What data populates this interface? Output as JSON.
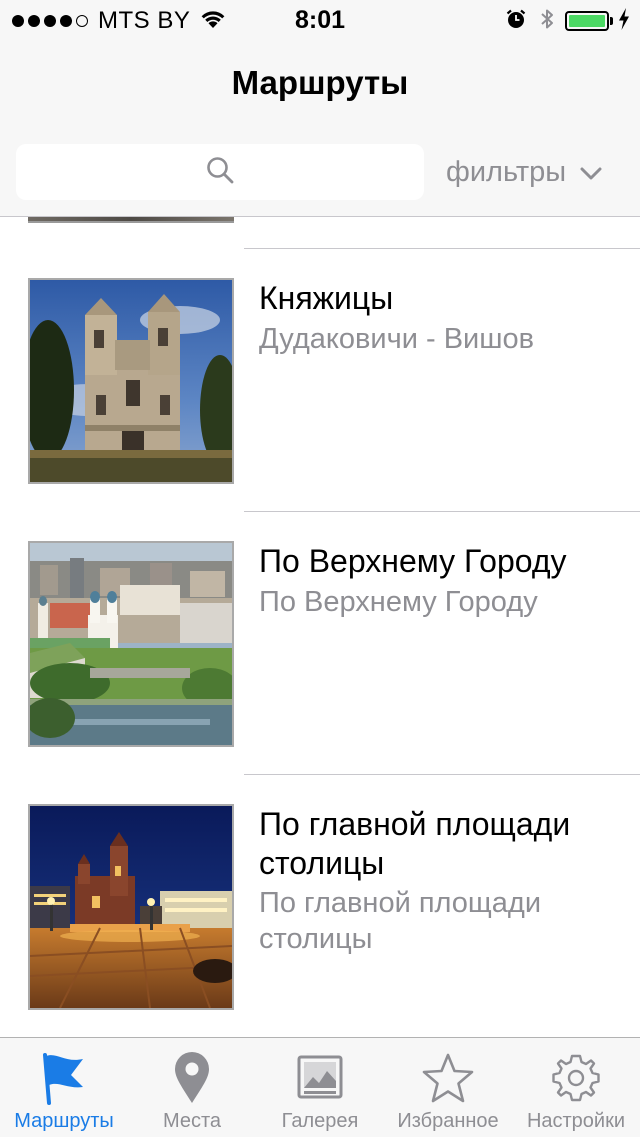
{
  "status_bar": {
    "carrier": "MTS BY",
    "time": "8:01",
    "battery_level": 1.0
  },
  "header": {
    "title": "Маршруты",
    "search_placeholder": "",
    "filters_label": "фильтры"
  },
  "routes": [
    {
      "title": "Княжицы",
      "subtitle": "Дудаковичи - Вишов",
      "image": "ruined-church-photo"
    },
    {
      "title": "По Верхнему Городу",
      "subtitle": "По Верхнему Городу",
      "image": "city-panorama-photo"
    },
    {
      "title": "По главной площади столицы",
      "subtitle": "По главной площади столицы",
      "image": "night-square-photo"
    }
  ],
  "tab_bar": {
    "items": [
      {
        "label": "Маршруты",
        "icon": "flag-icon",
        "active": true
      },
      {
        "label": "Места",
        "icon": "map-pin-icon",
        "active": false
      },
      {
        "label": "Галерея",
        "icon": "gallery-icon",
        "active": false
      },
      {
        "label": "Избранное",
        "icon": "star-icon",
        "active": false
      },
      {
        "label": "Настройки",
        "icon": "gear-icon",
        "active": false
      }
    ]
  },
  "colors": {
    "accent": "#1a7ce6",
    "inactive": "#8e8e93",
    "battery": "#4cd964",
    "bar_background": "#f7f7f7"
  }
}
